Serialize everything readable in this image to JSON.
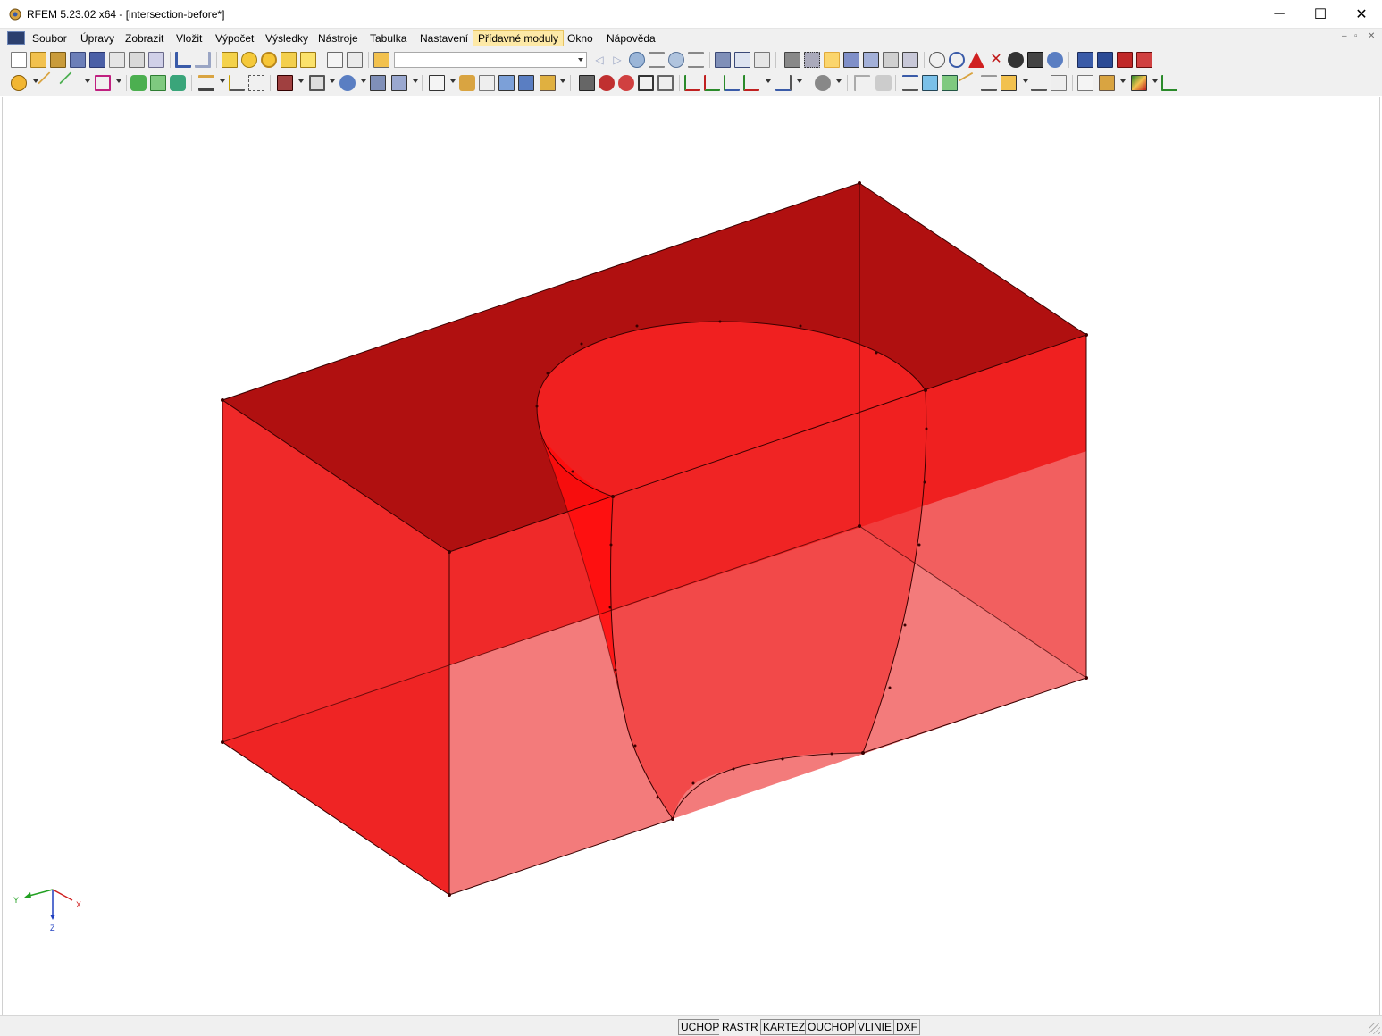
{
  "window": {
    "title": "RFEM 5.23.02 x64 - [intersection-before*]",
    "minimize_glyph": "─",
    "maximize_glyph": "☐",
    "close_glyph": "✕"
  },
  "menu": {
    "items": [
      {
        "label": "Soubor"
      },
      {
        "label": "Úpravy"
      },
      {
        "label": "Zobrazit"
      },
      {
        "label": "Vložit"
      },
      {
        "label": "Výpočet"
      },
      {
        "label": "Výsledky"
      },
      {
        "label": "Nástroje"
      },
      {
        "label": "Tabulka"
      },
      {
        "label": "Nastavení"
      },
      {
        "label": "Přídavné moduly",
        "active": true
      },
      {
        "label": "Okno"
      },
      {
        "label": "Nápověda"
      }
    ],
    "mdi_controls": [
      "–",
      "▫",
      "✕"
    ]
  },
  "toolbar": {
    "load_case_combo": ""
  },
  "axes": {
    "x_label": "X",
    "y_label": "Y",
    "z_label": "Z"
  },
  "model_colors": {
    "top_face": "#b01010",
    "side_face": "#ee2020",
    "bottom_face": "#f37b7b",
    "hole": "#f02020",
    "edge": "#3a0000"
  },
  "status": {
    "cells": [
      {
        "label": "UCHOP",
        "on": false
      },
      {
        "label": "RASTR",
        "on": true
      },
      {
        "label": "KARTEZ",
        "on": false
      },
      {
        "label": "OUCHOP",
        "on": false
      },
      {
        "label": "VLINIE",
        "on": false
      },
      {
        "label": "DXF",
        "on": false
      }
    ]
  }
}
